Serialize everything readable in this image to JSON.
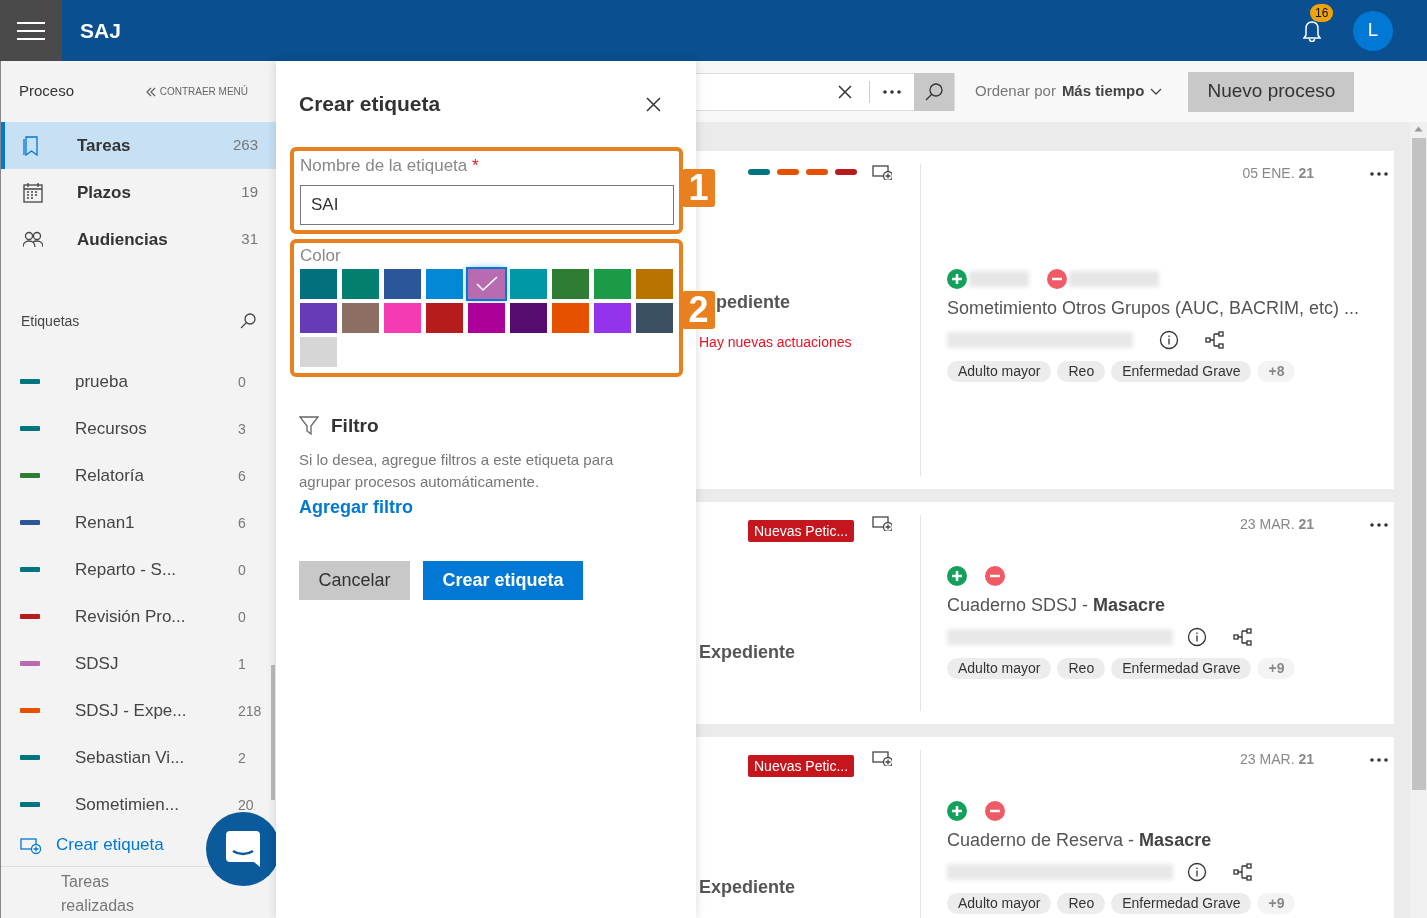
{
  "header": {
    "title": "SAJ",
    "notifications": "16",
    "avatar": "L"
  },
  "sidebar": {
    "section_title": "Proceso",
    "collapse": "CONTRAER MENÚ",
    "nav": [
      {
        "label": "Tareas",
        "count": "263",
        "selected": true
      },
      {
        "label": "Plazos",
        "count": "19",
        "selected": false
      },
      {
        "label": "Audiencias",
        "count": "31",
        "selected": false
      }
    ],
    "tags_title": "Etiquetas",
    "tags": [
      {
        "name": "prueba",
        "count": "0",
        "color": "#00747f"
      },
      {
        "name": "Recursos",
        "count": "3",
        "color": "#00747f"
      },
      {
        "name": "Relatoría",
        "count": "6",
        "color": "#2e7d32"
      },
      {
        "name": "Renan1",
        "count": "6",
        "color": "#2b579a"
      },
      {
        "name": "Reparto - S...",
        "count": "0",
        "color": "#00747f"
      },
      {
        "name": "Revisión Pro...",
        "count": "0",
        "color": "#b71c1c"
      },
      {
        "name": "SDSJ",
        "count": "1",
        "color": "#b86bb0"
      },
      {
        "name": "SDSJ - Expe...",
        "count": "218",
        "color": "#e65100"
      },
      {
        "name": "Sebastian Vi...",
        "count": "2",
        "color": "#00747f"
      },
      {
        "name": "Sometimien...",
        "count": "20",
        "color": "#00747f"
      }
    ],
    "create": "Crear etiqueta",
    "footer": "Tareas realizadas"
  },
  "toolbar": {
    "sort_label": "Ordenar por",
    "sort_value": "Más tiempo",
    "new_button": "Nuevo proceso"
  },
  "cards": [
    {
      "labels": [
        {
          "color": "#00747f"
        },
        {
          "color": "#e65100"
        },
        {
          "color": "#e65100"
        },
        {
          "color": "#b71c1c"
        }
      ],
      "type": "pediente",
      "notice": "Hay nuevas actuaciones",
      "date": "05 ENE. **21**",
      "names_hidden": true,
      "title": "Sometimiento Otros Grupos (AUC, BACRIM, etc) ...",
      "pills": [
        "Adulto mayor",
        "Reo",
        "Enfermedad Grave"
      ],
      "more": "+8"
    },
    {
      "badge": "Nuevas Petic...",
      "type": "Expediente",
      "date": "23 MAR. **21**",
      "names_hidden": false,
      "title": "Cuaderno SDSJ - **Masacre**",
      "pills": [
        "Adulto mayor",
        "Reo",
        "Enfermedad Grave"
      ],
      "more": "+9"
    },
    {
      "badge": "Nuevas Petic...",
      "type": "Expediente",
      "date": "23 MAR. **21**",
      "names_hidden": false,
      "title": "Cuaderno de Reserva - **Masacre**",
      "pills": [
        "Adulto mayor",
        "Reo",
        "Enfermedad Grave"
      ],
      "more": "+9"
    }
  ],
  "dialog": {
    "title": "Crear etiqueta",
    "name_label": "Nombre de la etiqueta",
    "required_mark": "*",
    "name_value": "SAI",
    "color_label": "Color",
    "colors": [
      {
        "color": "#03707e",
        "selected": false
      },
      {
        "color": "#037f6f",
        "selected": false
      },
      {
        "color": "#2b579a",
        "selected": false
      },
      {
        "color": "#0288d4",
        "selected": false
      },
      {
        "color": "#b86bb0",
        "selected": true
      },
      {
        "color": "#0097a7",
        "selected": false
      },
      {
        "color": "#2e7d32",
        "selected": false
      },
      {
        "color": "#1b9b48",
        "selected": false
      },
      {
        "color": "#b87300",
        "selected": false
      },
      {
        "color": "#673ab7",
        "selected": false
      },
      {
        "color": "#8d6e63",
        "selected": false
      },
      {
        "color": "#f53bb4",
        "selected": false
      },
      {
        "color": "#b71c1c",
        "selected": false
      },
      {
        "color": "#ad0099",
        "selected": false
      },
      {
        "color": "#560c6f",
        "selected": false
      },
      {
        "color": "#e65100",
        "selected": false
      },
      {
        "color": "#9333ea",
        "selected": false
      },
      {
        "color": "#3b5063",
        "selected": false
      },
      {
        "color": "#d6d6d6",
        "selected": false
      }
    ],
    "filter_title": "Filtro",
    "filter_text": "Si lo desea, agregue filtros a este etiqueta para agrupar procesos automáticamente.",
    "filter_link": "Agregar filtro",
    "cancel": "Cancelar",
    "submit": "Crear etiqueta"
  },
  "callouts": [
    "1",
    "2"
  ]
}
